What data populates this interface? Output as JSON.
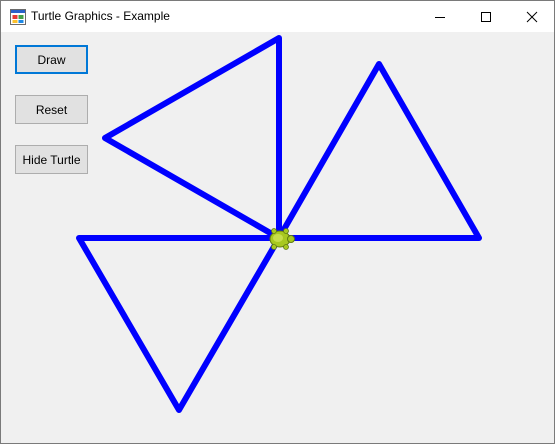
{
  "window": {
    "title": "Turtle Graphics - Example",
    "icon": "app-window-icon"
  },
  "controls": {
    "draw_label": "Draw",
    "reset_label": "Reset",
    "hide_turtle_label": "Hide Turtle"
  },
  "drawing": {
    "stroke_color": "#0000ff",
    "turtle_color": "#9acd32",
    "shape": "four triangles sharing one vertex",
    "turtle_icon": "turtle-icon"
  },
  "colors": {
    "accent": "#0078d7",
    "window_bg": "#f0f0f0",
    "titlebar_bg": "#ffffff"
  }
}
